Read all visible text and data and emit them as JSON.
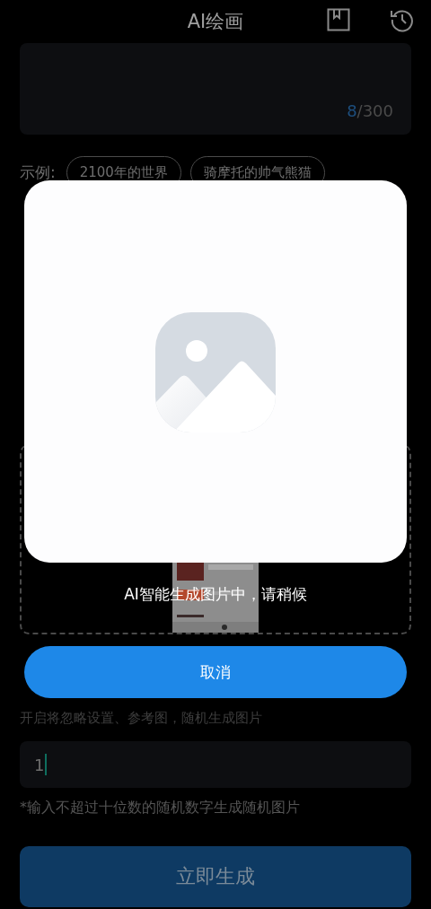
{
  "header": {
    "title": "AI绘画"
  },
  "prompt": {
    "count": "8",
    "limit": "/300"
  },
  "examples": {
    "label": "示例:",
    "chips": [
      "2100年的世界",
      "骑摩托的帅气熊猫"
    ]
  },
  "random": {
    "description": "开启将忽略设置、参考图，随机生成图片"
  },
  "seed": {
    "value": "1",
    "hint": "*输入不超过十位数的随机数字生成随机图片"
  },
  "generate_button": "立即生成",
  "dialog": {
    "message": "AI智能生成图片中，请稍候",
    "cancel": "取消"
  }
}
